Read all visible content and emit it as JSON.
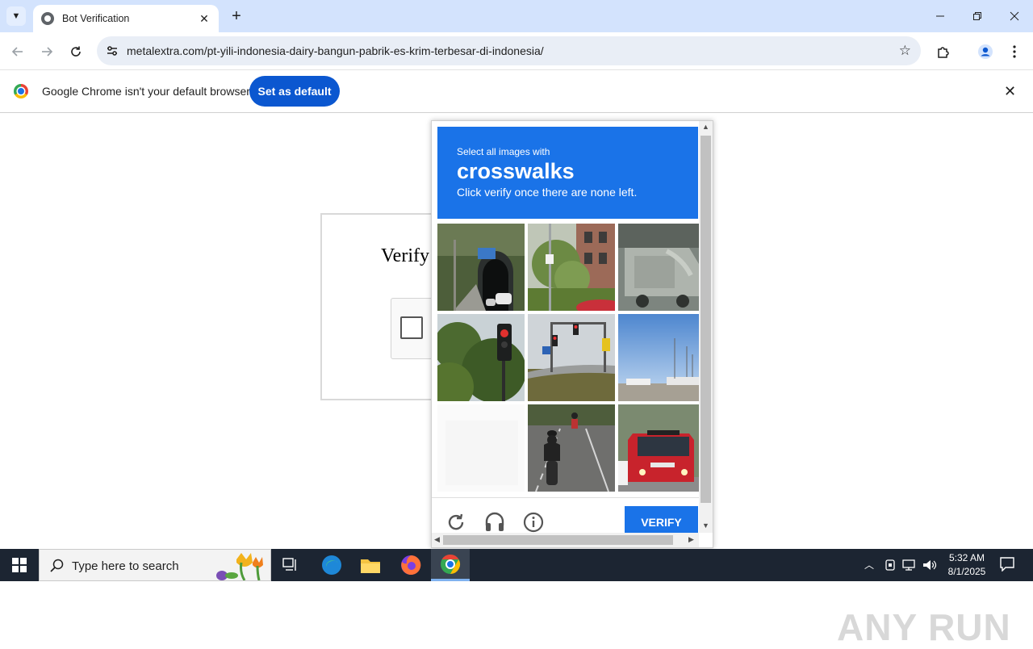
{
  "browser": {
    "tab_title": "Bot Verification",
    "url": "metalextra.com/pt-yili-indonesia-dairy-bangun-pabrik-es-krim-terbesar-di-indonesia/"
  },
  "infobar": {
    "message": "Google Chrome isn't your default browser",
    "button": "Set as default"
  },
  "page": {
    "verify_title": "Verify"
  },
  "captcha": {
    "pre_text": "Select all images with",
    "target": "crosswalks",
    "post_text": "Click verify once there are none left.",
    "verify_button": "VERIFY",
    "accent": "#1a73e8"
  },
  "taskbar": {
    "search_placeholder": "Type here to search",
    "time": "5:32 AM",
    "date": "8/1/2025"
  },
  "watermark": "ANY RUN"
}
